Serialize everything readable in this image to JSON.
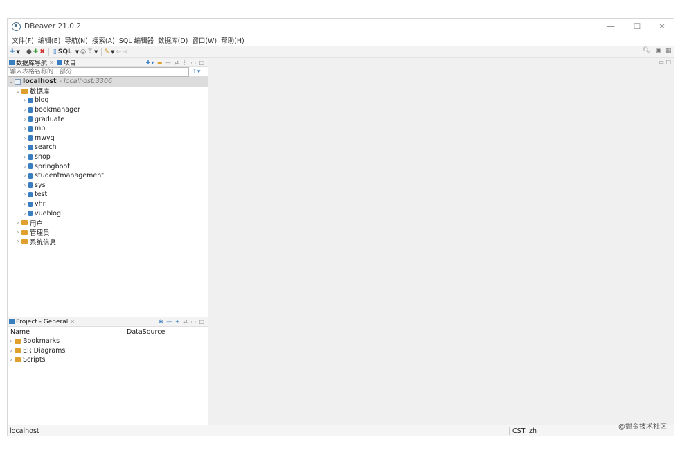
{
  "window": {
    "title": "DBeaver 21.0.2",
    "controls": {
      "minimize": "—",
      "maximize": "☐",
      "close": "✕"
    }
  },
  "menubar": {
    "items": [
      "文件(F)",
      "编辑(E)",
      "导航(N)",
      "搜索(A)",
      "SQL 编辑器",
      "数据库(D)",
      "窗口(W)",
      "帮助(H)"
    ]
  },
  "toolbar": {
    "sql_label": "SQL"
  },
  "navigator": {
    "tabs": [
      {
        "label": "数据库导航",
        "close": "✕"
      },
      {
        "label": "项目"
      }
    ],
    "filter_placeholder": "输入表格名称的一部分",
    "connection": {
      "name": "localhost",
      "host": "- localhost:3306"
    },
    "databases_folder": "数据库",
    "databases": [
      "blog",
      "bookmanager",
      "graduate",
      "mp",
      "mwyq",
      "search",
      "shop",
      "springboot",
      "studentmanagement",
      "sys",
      "test",
      "vhr",
      "vueblog"
    ],
    "other_folders": [
      "用户",
      "管理员",
      "系统信息"
    ]
  },
  "project": {
    "tab_label": "Project - General",
    "tab_close": "✕",
    "columns": {
      "name": "Name",
      "datasource": "DataSource"
    },
    "items": [
      "Bookmarks",
      "ER Diagrams",
      "Scripts"
    ]
  },
  "statusbar": {
    "left": "localhost",
    "timezone": "CST",
    "locale": "zh"
  },
  "watermark": "@掘金技术社区"
}
